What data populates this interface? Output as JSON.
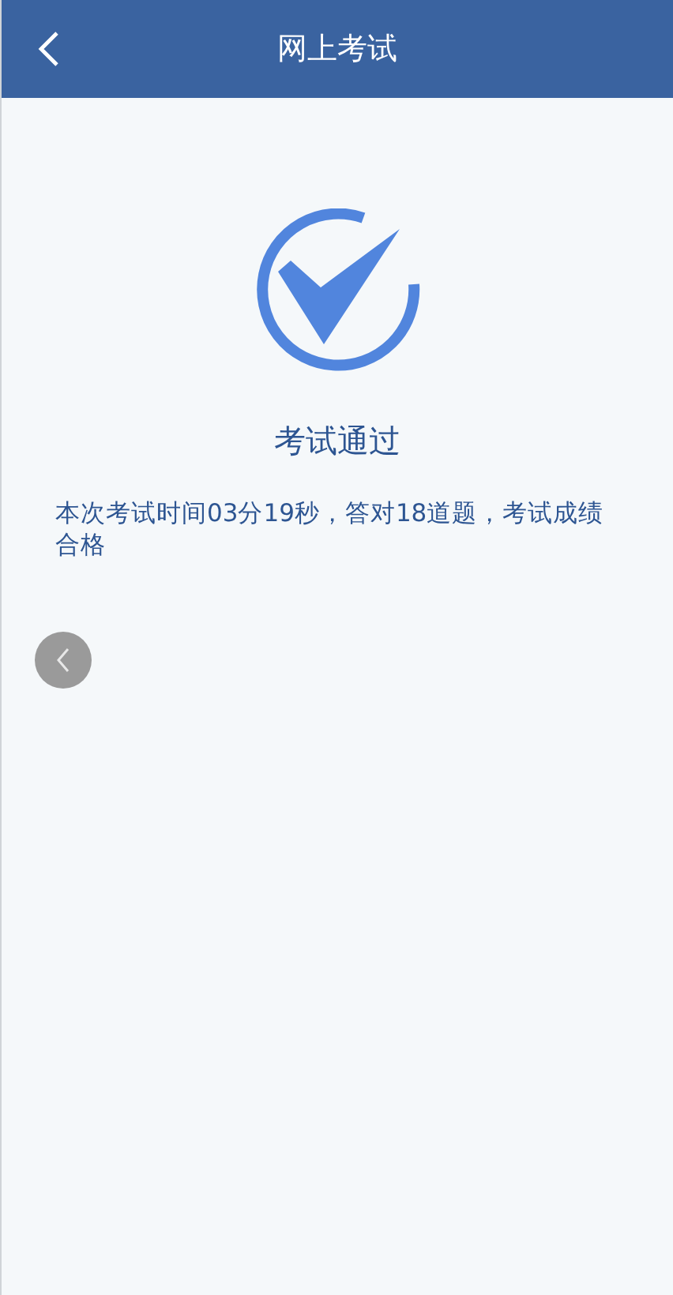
{
  "header": {
    "title": "网上考试"
  },
  "result": {
    "title": "考试通过",
    "message": "本次考试时间03分19秒，答对18道题，考试成绩合格"
  }
}
